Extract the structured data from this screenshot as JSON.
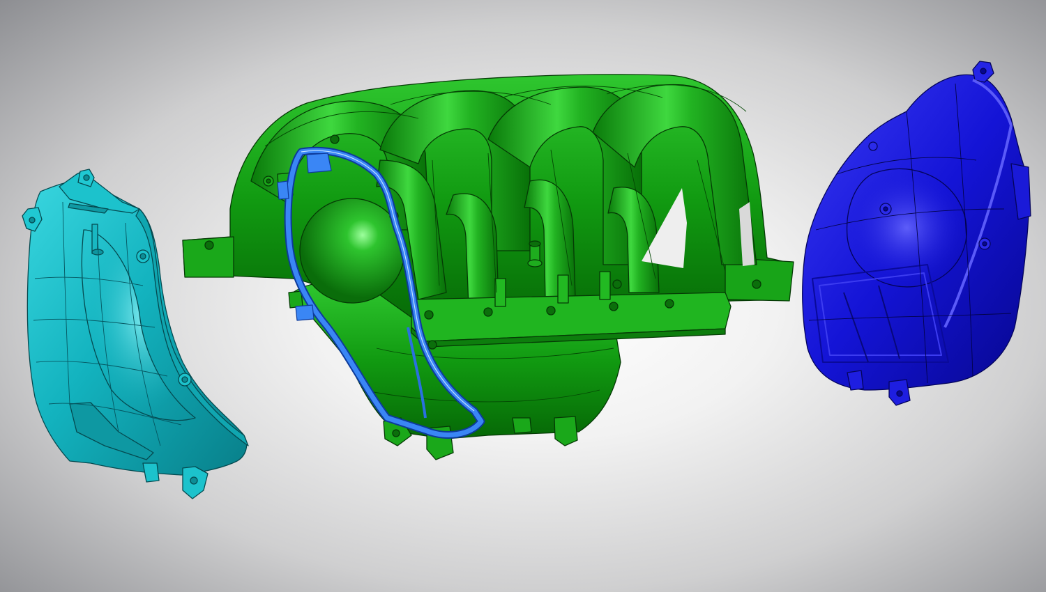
{
  "scene": {
    "view": "exploded-assembly-3d",
    "background_style": "radial grey gradient",
    "parts": [
      {
        "name": "left-cover",
        "color": "#14b8c4"
      },
      {
        "name": "intake-manifold",
        "color": "#12a012"
      },
      {
        "name": "gasket",
        "color": "#2f7cf2"
      },
      {
        "name": "right-cover",
        "color": "#1515d8"
      }
    ]
  }
}
